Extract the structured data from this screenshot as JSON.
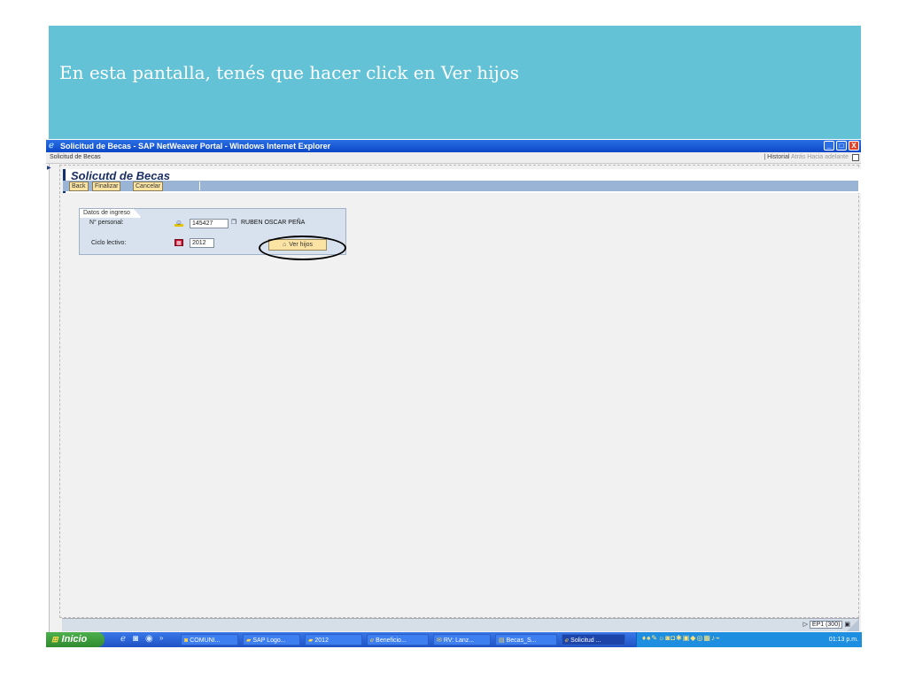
{
  "banner": {
    "text": "En esta pantalla, tenés que hacer click en Ver hijos",
    "color": "#64c2d6"
  },
  "window": {
    "title": "Solicitud de Becas - SAP NetWeaver Portal - Windows Internet Explorer",
    "controls": {
      "minimize": "_",
      "maximize": "□",
      "close": "X"
    }
  },
  "portal": {
    "title": "Solicitud de Becas",
    "nav": {
      "history": "Historial",
      "back": "Atrás",
      "forward": "Hacia adelante"
    }
  },
  "app": {
    "title": "Solicutd de Becas",
    "toolbar": {
      "back": "Back",
      "finish": "Finalizar",
      "cancel": "Cancelar"
    }
  },
  "form": {
    "group_title": "Datos de ingreso",
    "personal_label": "N° personal:",
    "personal_value": "145427",
    "employee_name": "RUBEN OSCAR PEÑA",
    "cycle_label": "Ciclo lectivo:",
    "cycle_value": "2012",
    "ver_hijos_label": "Ver hijos"
  },
  "status": {
    "system": "EP1 (300)"
  },
  "taskbar": {
    "start_label": "Inicio",
    "quicklaunch_more": "»",
    "tasks": [
      {
        "label": "COMUNI..."
      },
      {
        "label": "SAP Logo..."
      },
      {
        "label": "2012"
      },
      {
        "label": "Beneficio..."
      },
      {
        "label": "RV: Lanz..."
      },
      {
        "label": "Becas_S..."
      },
      {
        "label": "Solicitud ..."
      }
    ],
    "clock": "01:13 p.m."
  },
  "icons": [
    "ie-icon",
    "person-icon",
    "f4-help-icon",
    "calendar-icon",
    "ver-hijos-icon",
    "windows-logo-icon"
  ]
}
